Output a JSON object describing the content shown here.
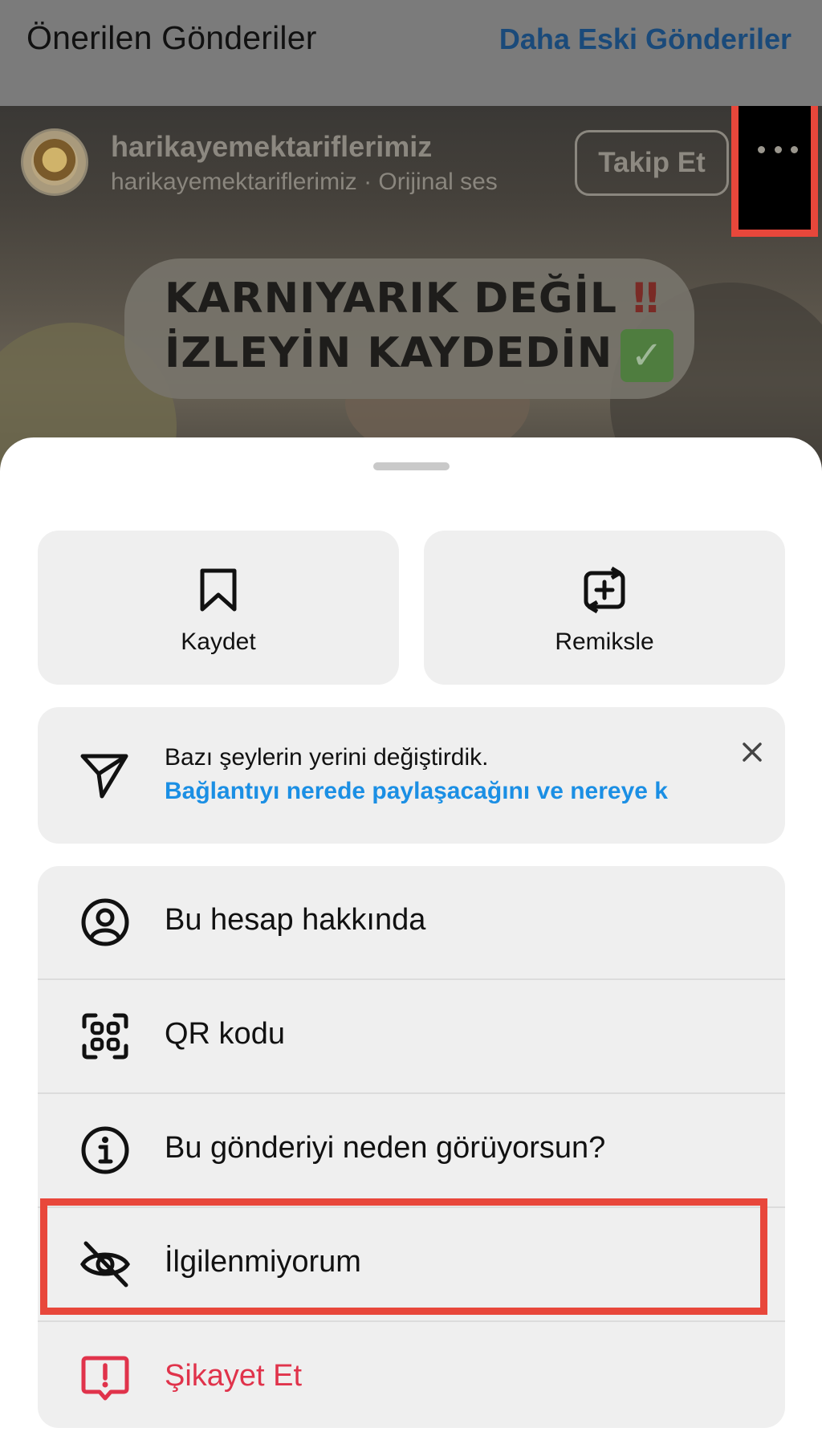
{
  "header": {
    "title": "Önerilen Gönderiler",
    "older_posts_link": "Daha Eski Gönderiler"
  },
  "post": {
    "username": "harikayemektariflerimiz",
    "subline": "harikayemektariflerimiz · Orijinal ses",
    "follow_label": "Takip Et",
    "caption_line1": "KARNIYARIK DEĞİL",
    "caption_line1_emoji": "‼",
    "caption_line2": "İZLEYİN KAYDEDİN",
    "caption_line2_emoji": "✓"
  },
  "sheet": {
    "actions": [
      {
        "label": "Kaydet",
        "icon": "bookmark-icon"
      },
      {
        "label": "Remiksle",
        "icon": "remix-icon"
      }
    ],
    "notice": {
      "title": "Bazı şeylerin yerini değiştirdik.",
      "link": "Bağlantıyı nerede paylaşacağını ve nereye k",
      "icon": "send-icon"
    },
    "menu": [
      {
        "label": "Bu hesap hakkında",
        "icon": "account-icon"
      },
      {
        "label": "QR kodu",
        "icon": "qr-code-icon"
      },
      {
        "label": "Bu gönderiyi neden görüyorsun?",
        "icon": "info-icon"
      },
      {
        "label": "İlgilenmiyorum",
        "icon": "eye-off-icon"
      },
      {
        "label": "Şikayet Et",
        "icon": "report-icon"
      }
    ]
  },
  "colors": {
    "accent_link": "#1b8fe4",
    "danger": "#e0334b",
    "highlight": "#e8473b"
  }
}
